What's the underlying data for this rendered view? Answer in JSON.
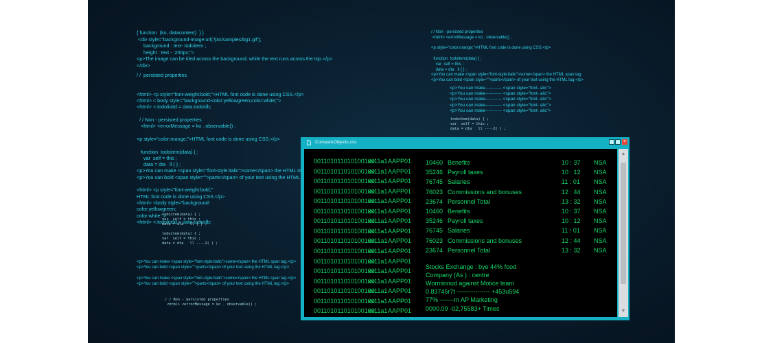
{
  "background": {
    "left_block_1": [
      "{ function  (ko, datacontext)  } }",
      " <div style=\"background-image:url('/pix/samples/bg1.gif');",
      "     background : text- todoitem ;",
      "     height : text - :200px;\">",
      "<p>The image can be tiled across the background, while the text runs across the top.</p>",
      "</div>"
    ],
    "left_block_2": [
      "/ /  persisted properties",
      "",
      "",
      "<html> <p style=\"font-weight:bold;\">HTML font code is done using CSS.</p>",
      "<html> < body style=\"background-color:yellowgreen;color:white;\">",
      "<html> <.todolistId = data.todoidb;",
      "",
      "  / / Non - persisted properties",
      "   <html> <errorMessage = ko . observable() ;",
      "",
      "<p style=\"color:orange;\">HTML font code is done using CSS.</p>",
      "",
      "   function  todoitem(data) { ;",
      "     var  self = this ;",
      "     data = dta   ll { } ;",
      "<p>You can make <span style=\"font-style:italic\">some</span> the HTML tag.</p>",
      "<p>You can bold <span style=\"\">parts</span> of your text using the HTML tag.</p>",
      "",
      "<html> <p style=\"font-weight:bold;\"",
      "HTML font code is done using CSS.</p>",
      "<html> <body style=\"background-",
      "color:yellowgreen;",
      "color:white;\">",
      "<html> <.todolistId = data.todoidb;"
    ],
    "left_mono": [
      "todoitem(data) { ;",
      "var  self = this ;",
      "data = dta   ll { } ;",
      "",
      "todoitem(data) { ;",
      "var  self = this ;",
      "data = dta   ll ----2( ) ;"
    ],
    "left_block_3": [
      "<p>You can make <span style=\"font-style:italic\">some</span> the HTML span tag.</p>",
      "<p>You can bold <span style=\"\">parts</span> of your text using the HTML tag.</p>",
      "",
      "<p>You can make <span style=\"font-style:italic\">some</span> the HTML span tag.</p>",
      "<p>You can bold <span style=\"\">parts</span> of your text using the HTML tag.</p>"
    ],
    "left_mono_2": [
      "/ / Non - persisted properties",
      " <html> <errorMessage = ko . observable() ;"
    ],
    "right_block_1": [
      "/ / Non - persisted properties",
      " <html> <errorMessage = ko . observable() ;",
      "",
      "<p style=\"color:orange;\">HTML font code is done using CSS.</p>",
      "",
      "  function  todoitem(data) { ;",
      "    var  self = this ;",
      "    data = dta   ll { } ;",
      "<p>You can make <span style=\"font-style:italic\">some</span> the HTML span tag.",
      "<p>You can bold <span style=\"\">parts</span> of your text using the HTML tag.</p>"
    ],
    "right_block_2": [
      "<p>You can make----------- <span style=\"font- alic\">",
      "<p>You can make----------- <span style=\"font- alic\">",
      "<p>You can make----------- <span style=\"font- alic\">",
      "<p>You can make----------- <span style=\"font- alic\">",
      "<p>You can make----------- <span style=\"font- alic\">"
    ],
    "right_mono": [
      "todoitem(data) { ;",
      "var  self = this ;",
      "data = dta   ll ----2( ) ;"
    ]
  },
  "window": {
    "title": "CompareObjects.css",
    "minimize_label": "",
    "maximize_label": "",
    "close_label": "×",
    "scroll_up": "▲",
    "scroll_down": "▼",
    "left_rows": [
      {
        "bin": "001101011010100100",
        "x": "xx11a1",
        "a": "AAPP01"
      },
      {
        "bin": "001101011010100100",
        "x": "xx11a1",
        "a": "AAPP01"
      },
      {
        "bin": "001101011010100100",
        "x": "xx11a1",
        "a": "AAPP01"
      },
      {
        "bin": "001101011010100100",
        "x": "xx11a1",
        "a": "AAPP01"
      },
      {
        "bin": "001101011010100100",
        "x": "xx11a1",
        "a": "AAPP01"
      },
      {
        "bin": "001101011010100100",
        "x": "xx11a1",
        "a": "AAPP01"
      },
      {
        "bin": "001101011010100100",
        "x": "xx11a1",
        "a": "AAPP01"
      },
      {
        "bin": "001101011010100100",
        "x": "xx11a1",
        "a": "AAPP01"
      },
      {
        "bin": "001101011010100100",
        "x": "xx11a1",
        "a": "AAPP01"
      },
      {
        "bin": "001101011010100100",
        "x": "xx11a1",
        "a": "AAPP01"
      },
      {
        "bin": "001101011010100100",
        "x": "xx11a1",
        "a": "AAPP01"
      },
      {
        "bin": "001101011010100100",
        "x": "xx11a1",
        "a": "AAPP01"
      },
      {
        "bin": "001101011010100100",
        "x": "xx11a1",
        "a": "AAPP01"
      },
      {
        "bin": "001101011010100100",
        "x": "xx11a1",
        "a": "AAPP01"
      },
      {
        "bin": "001101011010100100",
        "x": "xx11a1",
        "a": "AAPP01"
      },
      {
        "bin": "001101011010100100",
        "x": "xx11a1",
        "a": "AAPP01"
      }
    ],
    "entries": [
      {
        "num": "10460",
        "name": "Benefits",
        "time": "10  : 37",
        "code": "NSA"
      },
      {
        "num": "35246",
        "name": "Payroll taxes",
        "time": "10 : 12",
        "code": "NSA"
      },
      {
        "num": "76745",
        "name": "Salaries",
        "time": "11 : 01",
        "code": "NSA"
      },
      {
        "num": "76023",
        "name": "Commissions and bonuses",
        "time": "12 : 44",
        "code": "NSA"
      },
      {
        "num": "23674",
        "name": "Personnel Total",
        "time": "13 : 32",
        "code": "NSA"
      },
      {
        "num": "10460",
        "name": "Benefits",
        "time": "10  : 37",
        "code": "NSA"
      },
      {
        "num": "35246",
        "name": "Payroll taxes",
        "time": "10 : 12",
        "code": "NSA"
      },
      {
        "num": "76745",
        "name": "Salaries",
        "time": "11 : 01",
        "code": "NSA"
      },
      {
        "num": "76023",
        "name": "Commissions and bonuses",
        "time": "12 : 44",
        "code": "NSA"
      },
      {
        "num": "23674",
        "name": "Personnel Total",
        "time": "13 : 32",
        "code": "NSA"
      }
    ],
    "notes": [
      "Stocks Exchange : bye 44% food",
      "Company  (As ) : centre",
      "Worminnud  against Motice team",
      "0.83745r7t   ---------------- +453u594",
      "77% -------m AP Marketing",
      "0000.09 -02,75583+ Times"
    ]
  },
  "colors": {
    "accent": "#14b0c4",
    "terminal_text": "#16d86a",
    "code_text": "#2fd3e8",
    "close_button": "#e8473a"
  }
}
